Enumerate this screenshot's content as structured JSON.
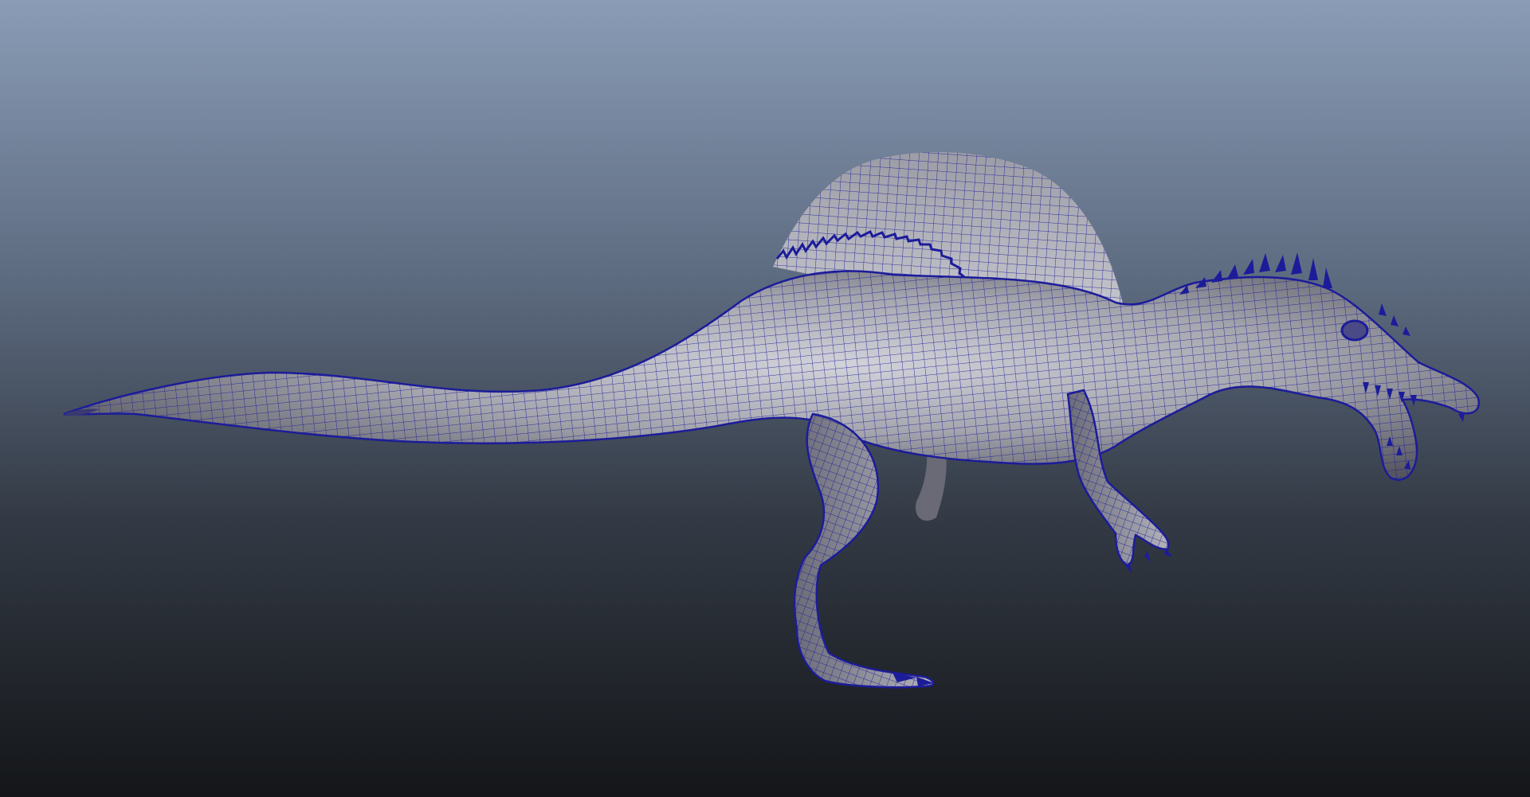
{
  "viewport": {
    "background_top": "#8a9cb6",
    "background_bottom": "#141619",
    "wireframe_color": "#1a1a8c",
    "shaded_color": "#9a9aa4"
  },
  "model": {
    "icon": "spinosaurus-mesh"
  }
}
